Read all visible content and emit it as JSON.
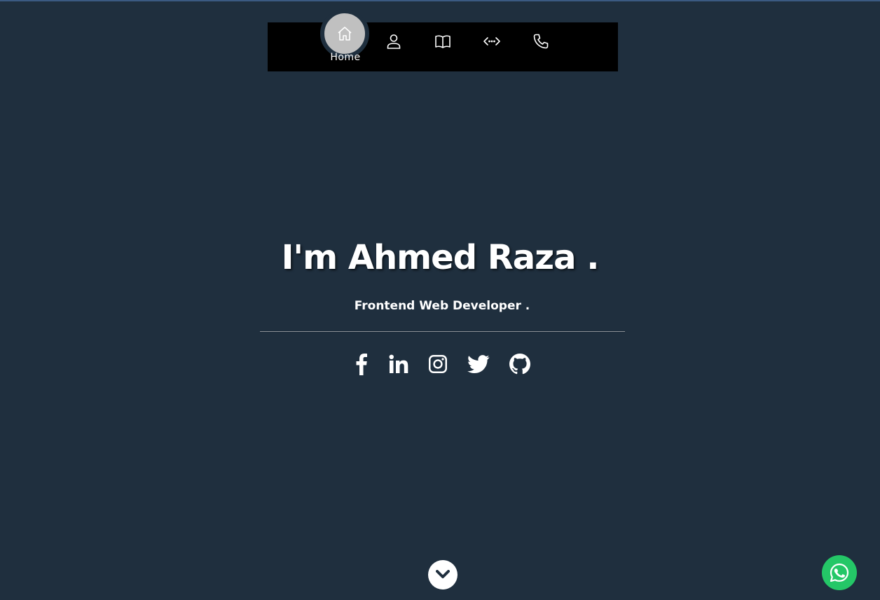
{
  "nav": {
    "items": [
      {
        "label": "Home",
        "icon": "home-icon",
        "active": true
      },
      {
        "label": "",
        "icon": "user-icon"
      },
      {
        "label": "",
        "icon": "book-icon"
      },
      {
        "label": "",
        "icon": "code-icon"
      },
      {
        "label": "",
        "icon": "phone-icon"
      }
    ],
    "active_label": "Home"
  },
  "hero": {
    "title": "I'm Ahmed Raza .",
    "subtitle": "Frontend Web Developer ."
  },
  "social": [
    {
      "name": "facebook",
      "icon": "facebook-icon"
    },
    {
      "name": "linkedin",
      "icon": "linkedin-icon"
    },
    {
      "name": "instagram",
      "icon": "instagram-icon"
    },
    {
      "name": "twitter",
      "icon": "twitter-icon"
    },
    {
      "name": "github",
      "icon": "github-icon"
    }
  ],
  "buttons": {
    "scroll_down_icon": "chevron-down-icon",
    "whatsapp_icon": "whatsapp-icon"
  },
  "colors": {
    "background": "#1f2f3e",
    "navbar": "#000000",
    "active_bubble": "#c0c0c0",
    "whatsapp": "#24c767"
  }
}
